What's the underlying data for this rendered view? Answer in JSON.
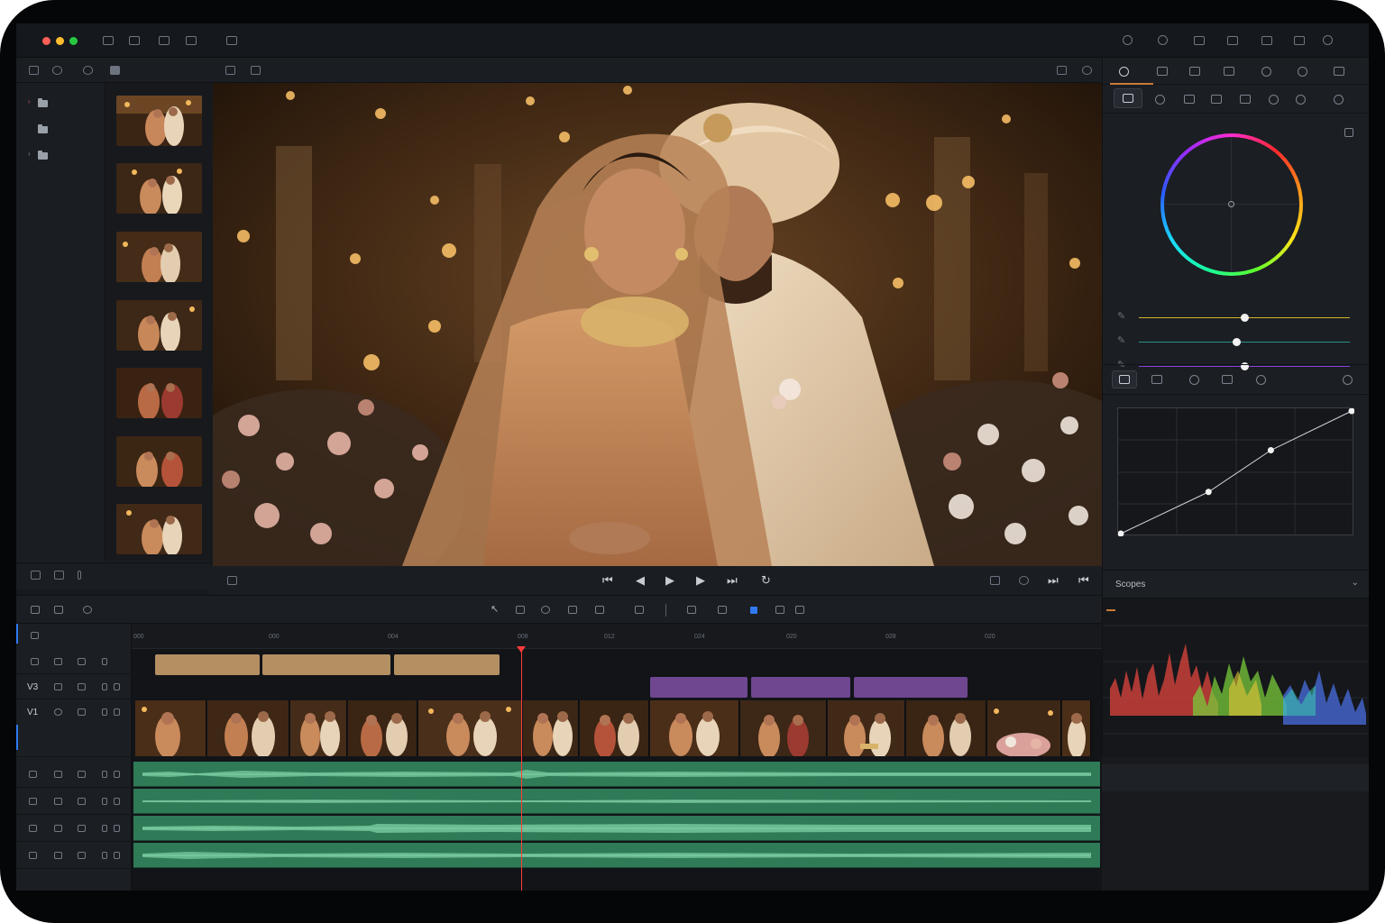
{
  "tracks": {
    "v3": "V3",
    "v1": "V1"
  },
  "ruler": {
    "ticks": [
      "000",
      "000",
      "004",
      "008",
      "012",
      "024",
      "020",
      "028",
      "020"
    ]
  },
  "scopes": {
    "title": "Scopes"
  },
  "colors": {
    "accent": "#2f7af0",
    "playhead": "#ff3a3a",
    "title_clips": "#b48f62",
    "fx_clips": "#6f4690",
    "audio": "#2f7a57"
  },
  "sliders": [
    {
      "value": 0.5,
      "color": "#d6b32a"
    },
    {
      "value": 0.46,
      "color": "#2a8f8a"
    },
    {
      "value": 0.5,
      "color": "#8a3fd6"
    }
  ],
  "curve_points": [
    [
      0,
      0
    ],
    [
      0.38,
      0.34
    ],
    [
      0.65,
      0.68
    ],
    [
      1,
      1
    ]
  ]
}
